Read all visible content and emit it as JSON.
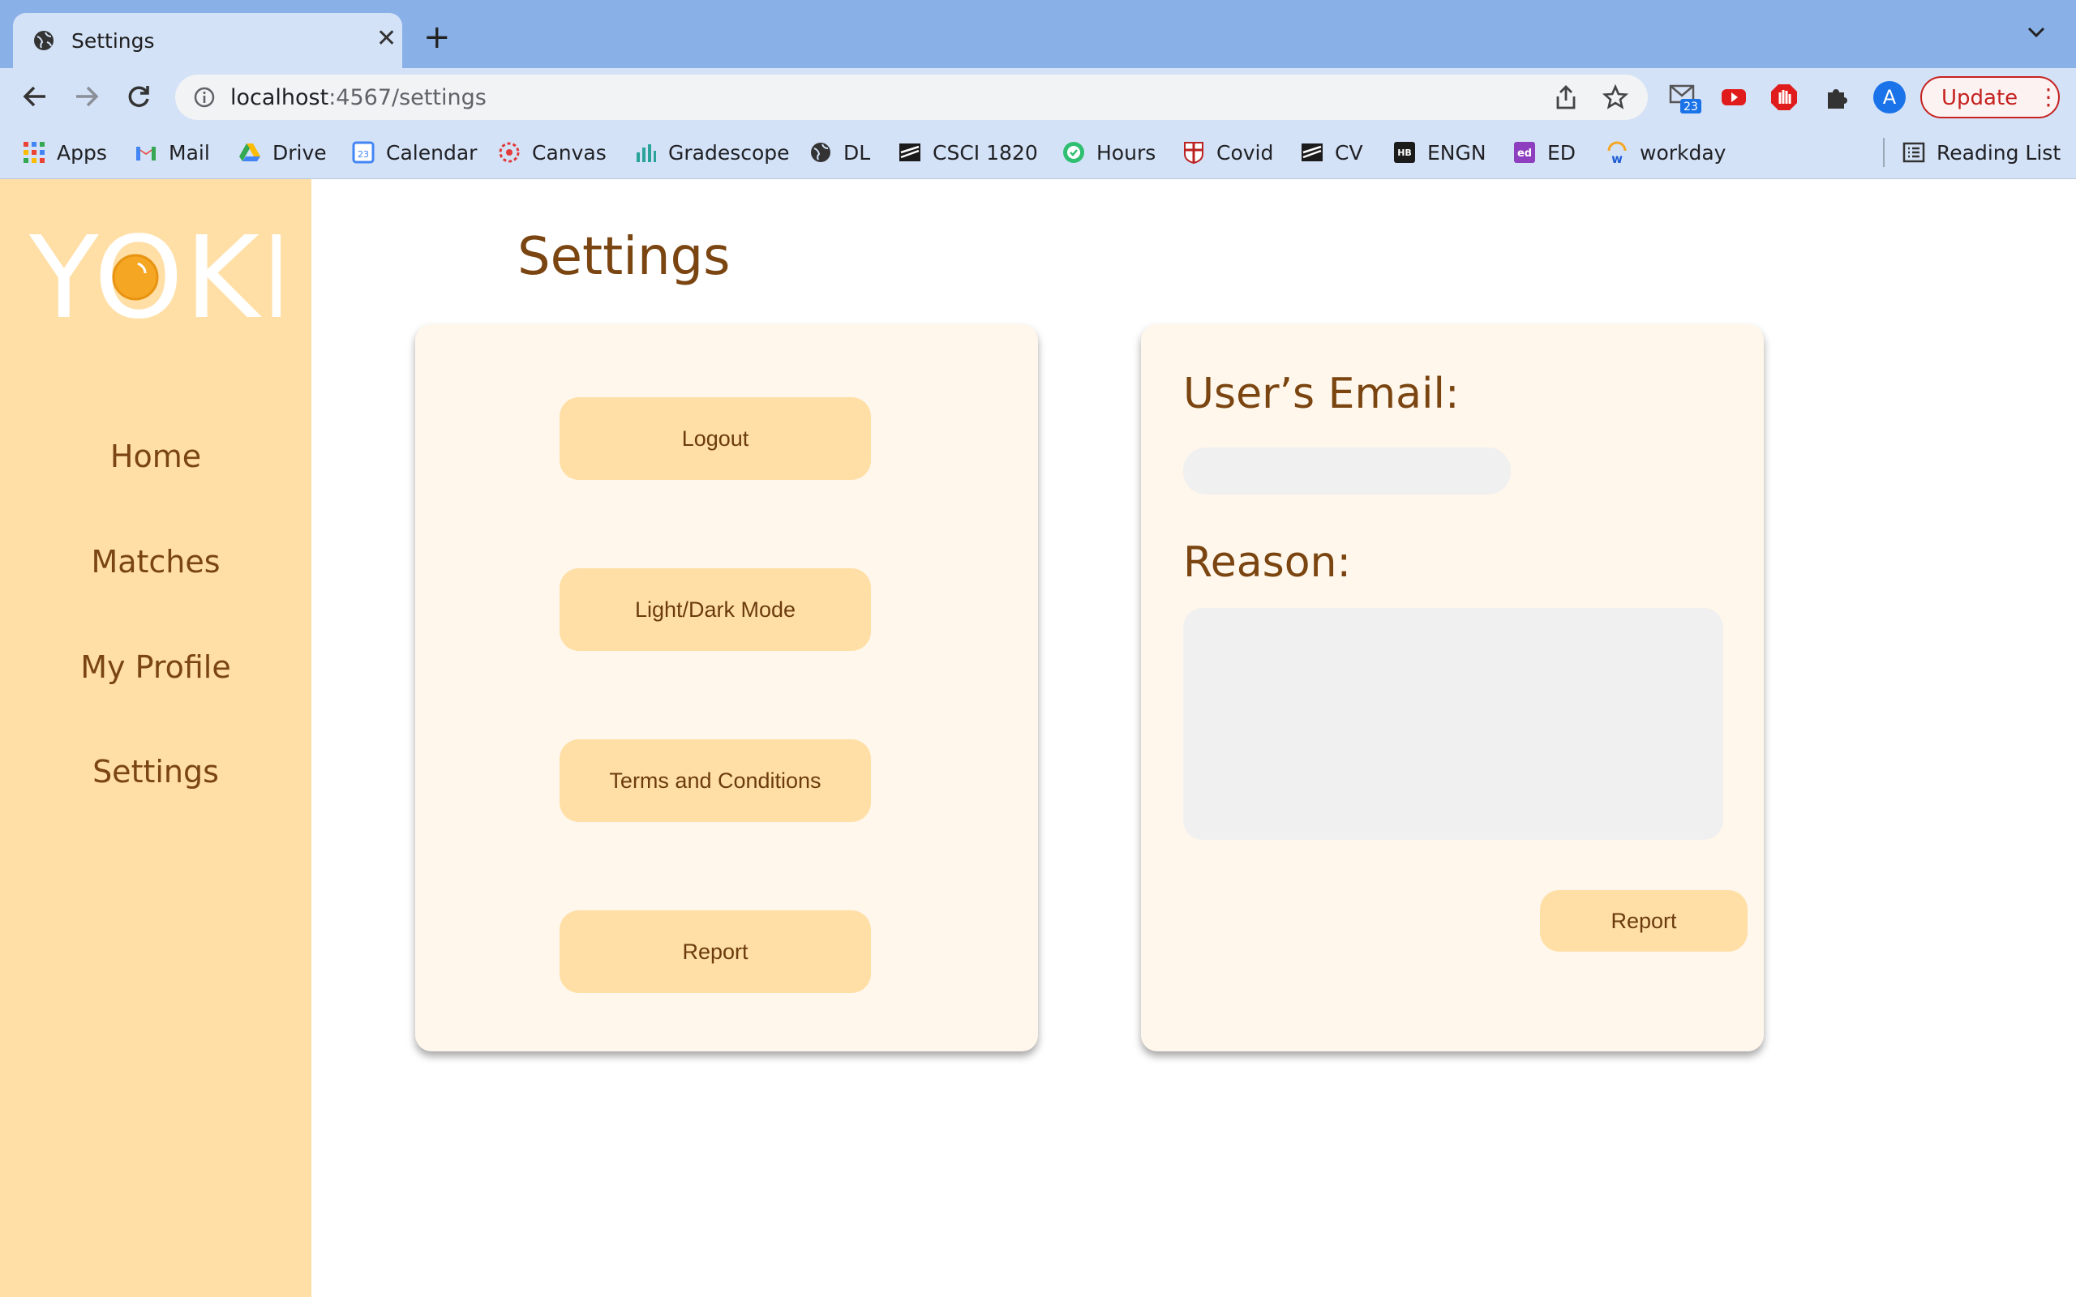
{
  "browser": {
    "tab_title": "Settings",
    "url_host": "localhost",
    "url_path": ":4567/settings",
    "mail_badge": "23",
    "avatar_letter": "A",
    "update_label": "Update",
    "bookmarks": [
      {
        "label": "Apps",
        "icon": "apps-grid-icon"
      },
      {
        "label": "Mail",
        "icon": "gmail-icon"
      },
      {
        "label": "Drive",
        "icon": "drive-icon"
      },
      {
        "label": "Calendar",
        "icon": "calendar-icon"
      },
      {
        "label": "Canvas",
        "icon": "canvas-icon"
      },
      {
        "label": "Gradescope",
        "icon": "gradescope-icon"
      },
      {
        "label": "DL",
        "icon": "globe-icon"
      },
      {
        "label": "CSCI 1820",
        "icon": "course-icon"
      },
      {
        "label": "Hours",
        "icon": "check-circle-icon"
      },
      {
        "label": "Covid",
        "icon": "shield-crest-icon"
      },
      {
        "label": "CV",
        "icon": "course-icon"
      },
      {
        "label": "ENGN",
        "icon": "hb-icon"
      },
      {
        "label": "ED",
        "icon": "ed-icon"
      },
      {
        "label": "workday",
        "icon": "workday-icon"
      }
    ],
    "reading_list": "Reading List"
  },
  "app": {
    "logo_text": "YOKI",
    "nav": [
      "Home",
      "Matches",
      "My Profile",
      "Settings"
    ],
    "page_title": "Settings",
    "settings_buttons": [
      "Logout",
      "Light/Dark Mode",
      "Terms and Conditions",
      "Report"
    ],
    "report_form": {
      "email_label": "User’s Email:",
      "email_value": "",
      "reason_label": "Reason:",
      "reason_value": "",
      "submit_label": "Report"
    }
  },
  "colors": {
    "sidebar": "#ffdfa6",
    "card": "#fff7eb",
    "brown_text": "#7a4511",
    "yolk": "#f5a623"
  }
}
